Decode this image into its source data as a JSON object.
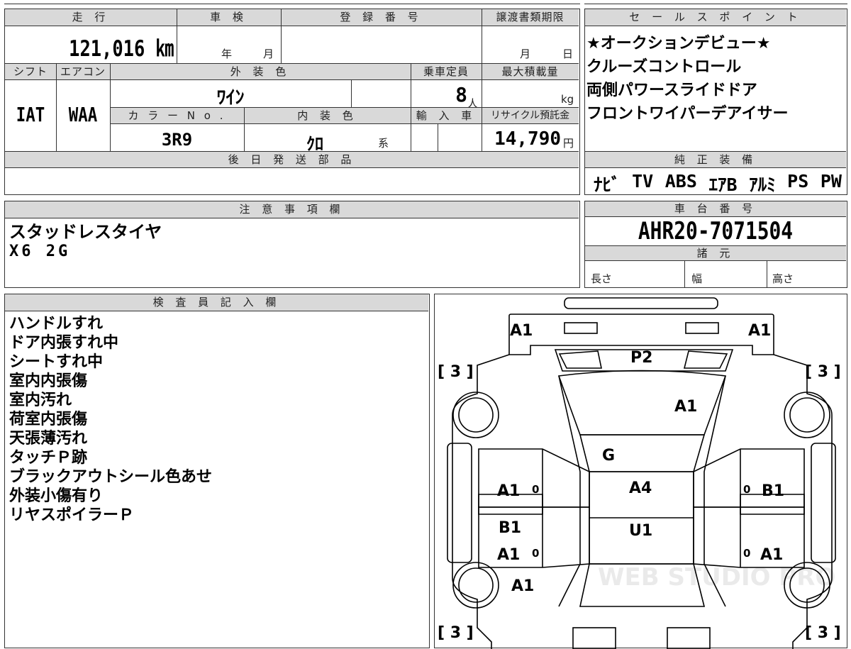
{
  "top_info": {
    "headers": {
      "mileage": "走 行",
      "inspection": "車 検",
      "registration_number": "登 録 番 号",
      "transfer_deadline": "譲渡書類期限",
      "shift": "シフト",
      "aircon": "エアコン",
      "exterior_color": "外 装 色",
      "capacity": "乗車定員",
      "max_load": "最大積載量",
      "color_no": "カ ラ ー N o .",
      "interior_color": "内 装 色",
      "import": "輸 入 車",
      "recycle_fee": "リサイクル預託金",
      "later_parts": "後 日 発 送 部 品"
    },
    "mileage_value": "121,016 ㎞",
    "inspection_year": "年",
    "inspection_month": "月",
    "transfer_month": "月",
    "transfer_day": "日",
    "shift_value": "IAT",
    "aircon_value": "WAA",
    "exterior_color_value": "ﾜｲﾝ",
    "capacity_value": "8",
    "capacity_unit": "人",
    "max_load_unit": "kg",
    "color_no_value": "3R9",
    "interior_color_value": "ｸﾛ",
    "interior_suffix": "系",
    "recycle_value": "14,790",
    "recycle_unit": "円"
  },
  "sales_points": {
    "header": "セ ー ル ス ポ イ ン ト",
    "lines": [
      "★オークションデビュー★",
      "クルーズコントロール",
      "両側パワースライドドア",
      "フロントワイパーデアイサー"
    ]
  },
  "equipment": {
    "header": "純 正 装 備",
    "items": [
      "ﾅﾋﾞ",
      "TV",
      "ABS",
      "ｴｱB",
      "ｱﾙﾐ",
      "PS",
      "PW"
    ]
  },
  "notes": {
    "header": "注 意 事 項 欄",
    "lines": [
      "スタッドレスタイヤ",
      "X6 2G"
    ]
  },
  "chassis": {
    "header": "車 台 番 号",
    "value": "AHR20-7071504",
    "specs_header": "諸 元",
    "length_label": "長さ",
    "width_label": "幅",
    "height_label": "高さ"
  },
  "inspector": {
    "header": "検 査 員 記 入 欄",
    "lines": [
      "ハンドルすれ",
      "ドア内張すれ中",
      "シートすれ中",
      "室内内張傷",
      "室内汚れ",
      "荷室内張傷",
      "天張薄汚れ",
      "タッチＰ跡",
      "ブラックアウトシール色あせ",
      "外装小傷有り",
      "リヤスポイラーＰ"
    ]
  },
  "diagram": {
    "tire_label_fl": "[ 3 ]",
    "tire_label_fr": "[ 3 ]",
    "tire_label_rl": "[ 3 ]",
    "tire_label_rr": "[ 3 ]",
    "marks": {
      "front_left_corner": "A1",
      "front_right_corner": "A1",
      "windshield_top": "P2",
      "hood": "A1",
      "windshield": "G",
      "roof_front": "A4",
      "roof_rear": "U1",
      "left_front_door": "A1",
      "left_rear_door_top": "B1",
      "left_rear_door": "A1",
      "left_rear_quarter": "A1",
      "right_front_door": "B1",
      "right_rear_door": "A1",
      "zero_1": "0",
      "zero_2": "0",
      "zero_3": "0",
      "zero_4": "0"
    },
    "watermark": "WEB STUDIO PRO"
  }
}
